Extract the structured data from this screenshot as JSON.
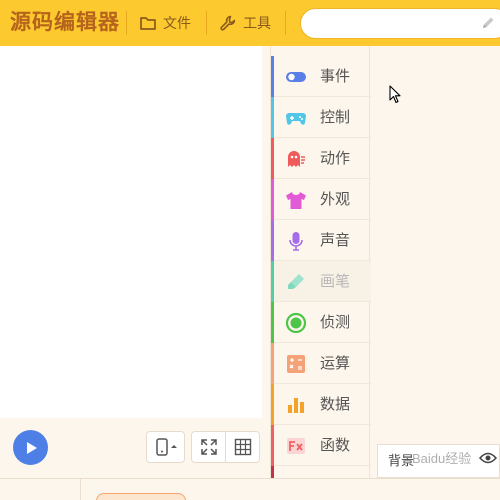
{
  "app": {
    "title": "源码编辑器"
  },
  "toolbar": {
    "file_label": "文件",
    "tools_label": "工具",
    "search_placeholder": "",
    "file_icon": "folder-icon",
    "tools_icon": "wrench-icon"
  },
  "categories": [
    {
      "label": "事件",
      "icon": "toggle-icon",
      "color": "#5b7fe8"
    },
    {
      "label": "控制",
      "icon": "gamepad-icon",
      "color": "#53c5e8"
    },
    {
      "label": "动作",
      "icon": "ghost-icon",
      "color": "#ef5a5a"
    },
    {
      "label": "外观",
      "icon": "shirt-icon",
      "color": "#e25ad5"
    },
    {
      "label": "声音",
      "icon": "microphone-icon",
      "color": "#a56ee8"
    },
    {
      "label": "画笔",
      "icon": "highlighter-icon",
      "color": "#4ecfa6",
      "disabled": true
    },
    {
      "label": "侦测",
      "icon": "target-icon",
      "color": "#4cc548"
    },
    {
      "label": "运算",
      "icon": "calculator-icon",
      "color": "#f4a277"
    },
    {
      "label": "数据",
      "icon": "bar-chart-icon",
      "color": "#f3a22a"
    },
    {
      "label": "函数",
      "icon": "function-icon",
      "color": "#f06262"
    }
  ],
  "sprite_panel": {
    "label": "背景",
    "watermark": "Baidu经验"
  }
}
